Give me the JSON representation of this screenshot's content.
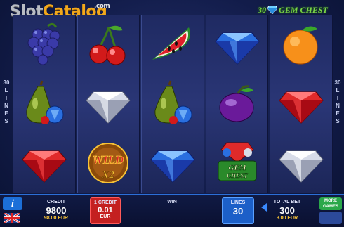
{
  "header": {
    "logo_part1": "Slot",
    "logo_part2": "Catalog",
    "logo_suffix": ".com",
    "game_title_left": "30",
    "game_title_right": "GEM CHEST"
  },
  "side_labels": {
    "left": [
      "30",
      "L",
      "I",
      "N",
      "E",
      "S"
    ],
    "right": [
      "30",
      "L",
      "I",
      "N",
      "E",
      "S"
    ]
  },
  "reels": [
    [
      "grapes",
      "pear-gem",
      "red-diamond"
    ],
    [
      "cherries",
      "white-diamond",
      "wild-x2"
    ],
    [
      "watermelon",
      "pear-gem",
      "blue-diamond"
    ],
    [
      "blue-diamond",
      "plum",
      "gem-chest"
    ],
    [
      "orange",
      "red-diamond",
      "white-diamond"
    ]
  ],
  "wild": {
    "line1": "WILD",
    "line2": "X2"
  },
  "gem_chest": {
    "line1": "GEM",
    "line2": "CHEST"
  },
  "panel": {
    "info_label": "i",
    "credit_label": "CREDIT",
    "credit_value": "9800",
    "credit_eur": "98.00 EUR",
    "denom_label": "1 CREDIT",
    "denom_value": "0.01",
    "denom_currency": "EUR",
    "win_label": "WIN",
    "lines_label": "LINES",
    "lines_value": "30",
    "bet_label": "TOTAL BET",
    "bet_value": "300",
    "bet_eur": "3.00 EUR",
    "more_games_line1": "MORE",
    "more_games_line2": "GAMES"
  },
  "colors": {
    "accent_blue": "#1c5fc8",
    "denom_red": "#c42020",
    "more_green": "#2aa84a",
    "highlight_yellow": "#f7c236"
  }
}
